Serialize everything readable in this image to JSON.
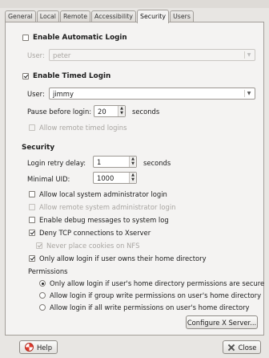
{
  "tabs": [
    "General",
    "Local",
    "Remote",
    "Accessibility",
    "Security",
    "Users"
  ],
  "auto_login": {
    "checkbox_label": "Enable Automatic Login",
    "checked": false,
    "user_label": "User:",
    "user_value": "peter"
  },
  "timed_login": {
    "checkbox_label": "Enable Timed Login",
    "checked": true,
    "user_label": "User:",
    "user_value": "jimmy",
    "pause_label": "Pause before login:",
    "pause_value": "20",
    "pause_unit": "seconds",
    "remote_label": "Allow remote timed logins",
    "remote_checked": false
  },
  "security": {
    "heading": "Security",
    "retry_label": "Login retry delay:",
    "retry_value": "1",
    "retry_unit": "seconds",
    "min_uid_label": "Minimal UID:",
    "min_uid_value": "1000",
    "options": [
      {
        "label": "Allow local system administrator login",
        "checked": false,
        "enabled": true
      },
      {
        "label": "Allow remote system administrator login",
        "checked": false,
        "enabled": false
      },
      {
        "label": "Enable debug messages to system log",
        "checked": false,
        "enabled": true
      },
      {
        "label": "Deny TCP connections to Xserver",
        "checked": true,
        "enabled": true
      },
      {
        "label": "Never place cookies on NFS",
        "checked": true,
        "enabled": false
      },
      {
        "label": "Only allow login if user owns their home directory",
        "checked": true,
        "enabled": true
      }
    ],
    "permissions_heading": "Permissions",
    "permission_options": [
      {
        "label": "Only allow login if user's home directory permissions are secure",
        "selected": true
      },
      {
        "label": "Allow login if group write permissions on user's home directory",
        "selected": false
      },
      {
        "label": "Allow login if all write permissions on user's home directory",
        "selected": false
      }
    ],
    "configure_button": "Configure X Server..."
  },
  "footer": {
    "help_button": "Help",
    "close_button": "Close"
  }
}
